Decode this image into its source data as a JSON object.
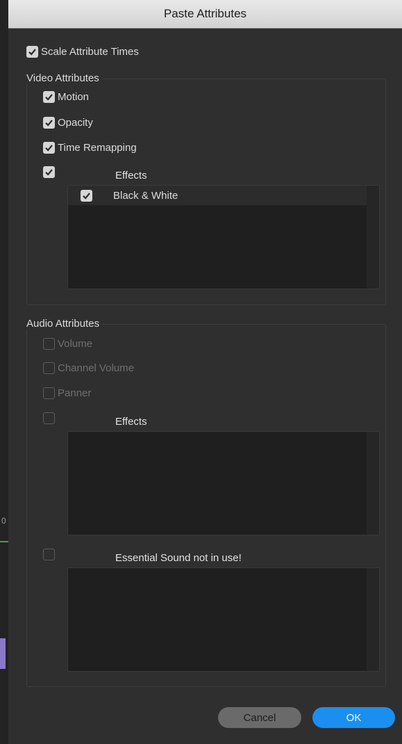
{
  "dialog": {
    "title": "Paste Attributes",
    "scale_attribute_times": {
      "label": "Scale Attribute Times",
      "checked": true
    }
  },
  "video": {
    "group_title": "Video Attributes",
    "motion": {
      "label": "Motion",
      "checked": true
    },
    "opacity": {
      "label": "Opacity",
      "checked": true
    },
    "time_remapping": {
      "label": "Time Remapping",
      "checked": true
    },
    "effects": {
      "header": "Effects",
      "checked": true,
      "items": [
        {
          "label": "Black & White",
          "checked": true
        }
      ]
    }
  },
  "audio": {
    "group_title": "Audio Attributes",
    "volume": {
      "label": "Volume",
      "checked": false,
      "enabled": false
    },
    "channel_volume": {
      "label": "Channel Volume",
      "checked": false,
      "enabled": false
    },
    "panner": {
      "label": "Panner",
      "checked": false,
      "enabled": false
    },
    "effects": {
      "header": "Effects",
      "checked": false,
      "items": []
    },
    "essential_sound": {
      "header": "Essential Sound not in use!",
      "checked": false
    }
  },
  "buttons": {
    "cancel_label": "Cancel",
    "ok_label": "OK"
  },
  "colors": {
    "dialog_bg": "#2f2f2f",
    "list_bg": "#1f1f1f",
    "ok_button": "#1a8ff0",
    "cancel_button": "#6a6a6a",
    "check_fill": "#d6d6d6"
  },
  "backdrop_edge_glyph": "0"
}
